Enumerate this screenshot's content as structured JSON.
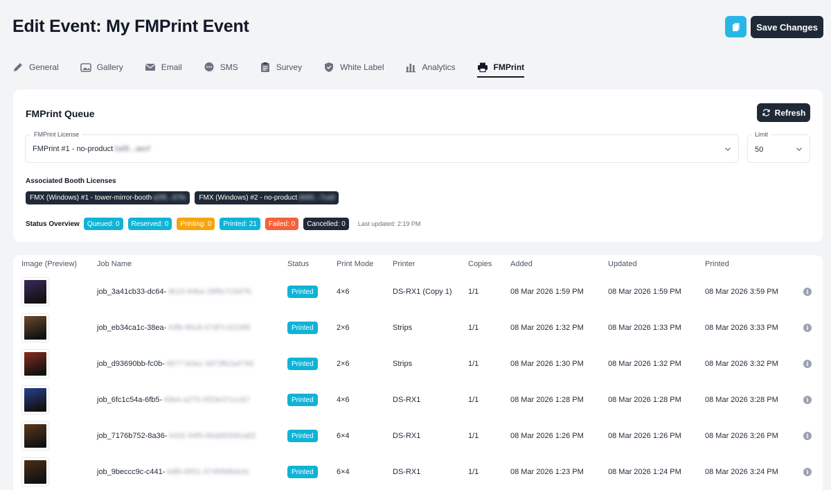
{
  "header": {
    "title": "Edit Event: My FMPrint Event",
    "save_label": "Save Changes"
  },
  "tabs": [
    {
      "label": "General",
      "icon": "pencil-icon"
    },
    {
      "label": "Gallery",
      "icon": "image-icon"
    },
    {
      "label": "Email",
      "icon": "envelope-icon"
    },
    {
      "label": "SMS",
      "icon": "chat-bubble-icon"
    },
    {
      "label": "Survey",
      "icon": "clipboard-icon"
    },
    {
      "label": "White Label",
      "icon": "shield-icon"
    },
    {
      "label": "Analytics",
      "icon": "bar-chart-icon"
    },
    {
      "label": "FMPrint",
      "icon": "printer-icon",
      "active": true
    }
  ],
  "queue": {
    "title": "FMPrint Queue",
    "refresh_label": "Refresh",
    "license_label": "FMPrint License",
    "license_value": "FMPrint #1 - no-product",
    "license_suffix": "0af8...aecf",
    "limit_label": "Limit",
    "limit_value": "50",
    "associated_title": "Associated Booth Licenses",
    "booth_licenses": [
      {
        "label": "FMX (Windows) #1 - tower-mirror-booth",
        "suffix": "a2f8...87fe"
      },
      {
        "label": "FMX (Windows) #2 - no-product",
        "suffix": "d685...7ca9"
      }
    ],
    "status_label": "Status Overview",
    "statuses": [
      {
        "label": "Queued: 0",
        "color": "#10b3d6"
      },
      {
        "label": "Reserved: 0",
        "color": "#10b3d6"
      },
      {
        "label": "Printing: 0",
        "color": "#f5a50b"
      },
      {
        "label": "Printed: 21",
        "color": "#10b3d6"
      },
      {
        "label": "Failed: 0",
        "color": "#f2613a"
      },
      {
        "label": "Cancelled: 0",
        "color": "#1f2937"
      }
    ],
    "last_updated": "Last updated: 2:19 PM"
  },
  "table": {
    "headers": [
      "Image (Preview)",
      "Job Name",
      "Status",
      "Print Mode",
      "Printer",
      "Copies",
      "Added",
      "Updated",
      "Printed"
    ],
    "rows": [
      {
        "job": "job_3a41cb33-dc64-",
        "job_hidden": "4b10-84ba-28f9c7c5d7fc",
        "status": "Printed",
        "mode": "4×6",
        "printer": "DS-RX1 (Copy 1)",
        "copies": "1/1",
        "added": "08 Mar 2026 1:59 PM",
        "updated": "08 Mar 2026 1:59 PM",
        "printed": "08 Mar 2026 3:59 PM",
        "thumb": "#3b2a5c"
      },
      {
        "job": "job_eb34ca1c-38ea-",
        "job_hidden": "43fb-85c8-07df7c3229f9",
        "status": "Printed",
        "mode": "2×6",
        "printer": "Strips",
        "copies": "1/1",
        "added": "08 Mar 2026 1:32 PM",
        "updated": "08 Mar 2026 1:33 PM",
        "printed": "08 Mar 2026 3:33 PM",
        "thumb": "#6b4a2e"
      },
      {
        "job": "job_d93690bb-fc0b-",
        "job_hidden": "4677-b0a1-3d73fb2a4766",
        "status": "Printed",
        "mode": "2×6",
        "printer": "Strips",
        "copies": "1/1",
        "added": "08 Mar 2026 1:30 PM",
        "updated": "08 Mar 2026 1:32 PM",
        "printed": "08 Mar 2026 3:32 PM",
        "thumb": "#8a2c1f"
      },
      {
        "job": "job_6fc1c54a-6fb5-",
        "job_hidden": "49b4-a270-0f20e37cccb7",
        "status": "Printed",
        "mode": "4×6",
        "printer": "DS-RX1",
        "copies": "1/1",
        "added": "08 Mar 2026 1:28 PM",
        "updated": "08 Mar 2026 1:28 PM",
        "printed": "08 Mar 2026 3:28 PM",
        "thumb": "#2a3f8f"
      },
      {
        "job": "job_7176b752-8a36-",
        "job_hidden": "4432-94f0-66ab8358ca82",
        "status": "Printed",
        "mode": "6×4",
        "printer": "DS-RX1",
        "copies": "1/1",
        "added": "08 Mar 2026 1:26 PM",
        "updated": "08 Mar 2026 1:26 PM",
        "printed": "08 Mar 2026 3:26 PM",
        "thumb": "#5a3a1c"
      },
      {
        "job": "job_9beccc9c-c441-",
        "job_hidden": "4df6-8851-474f0fd8eb3c",
        "status": "Printed",
        "mode": "6×4",
        "printer": "DS-RX1",
        "copies": "1/1",
        "added": "08 Mar 2026 1:23 PM",
        "updated": "08 Mar 2026 1:24 PM",
        "printed": "08 Mar 2026 3:24 PM",
        "thumb": "#4a2f18"
      }
    ]
  }
}
